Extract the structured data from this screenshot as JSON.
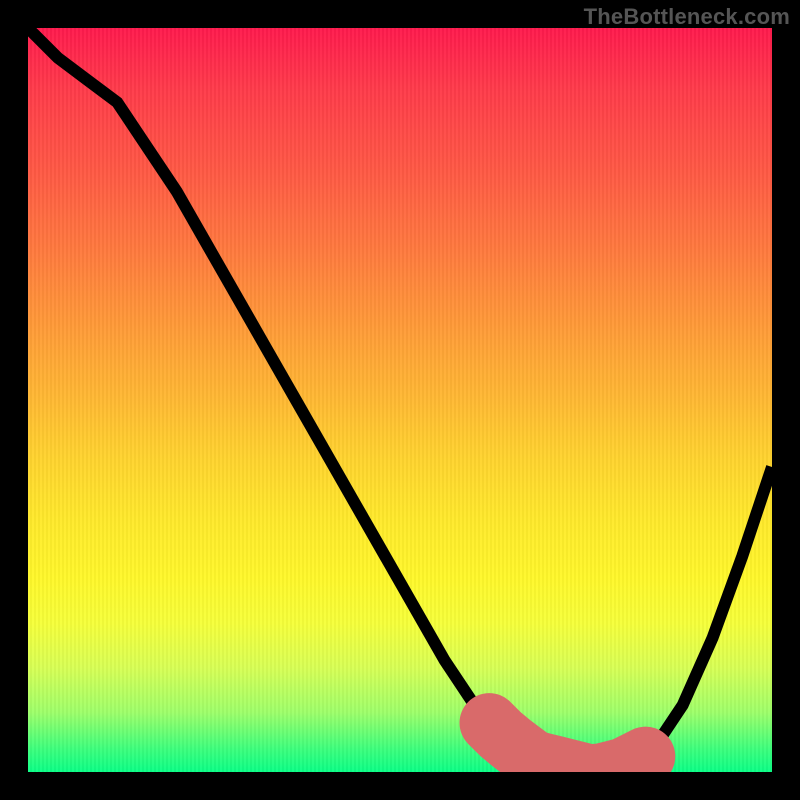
{
  "watermark": "TheBottleneck.com",
  "colors": {
    "frame": "#000000",
    "curve": "#000000",
    "highlight": "#d96a6a",
    "gradient_top": "#ff1a4d",
    "gradient_bottom": "#0aff86"
  },
  "chart_data": {
    "type": "line",
    "title": "",
    "xlabel": "",
    "ylabel": "",
    "xlim": [
      0,
      100
    ],
    "ylim": [
      0,
      100
    ],
    "x": [
      0,
      4,
      8,
      12,
      16,
      20,
      24,
      28,
      32,
      36,
      40,
      44,
      48,
      52,
      56,
      60,
      64,
      68,
      72,
      76,
      80,
      84,
      88,
      92,
      96,
      100
    ],
    "values": [
      100,
      96,
      93,
      90,
      84,
      78,
      71,
      64,
      57,
      50,
      43,
      36,
      29,
      22,
      15,
      9,
      5,
      2,
      1,
      0,
      1,
      3,
      9,
      18,
      29,
      41
    ],
    "annotations": [
      {
        "type": "highlight-range",
        "x_range": [
          62,
          83
        ],
        "note": "near-minimum band"
      }
    ]
  }
}
